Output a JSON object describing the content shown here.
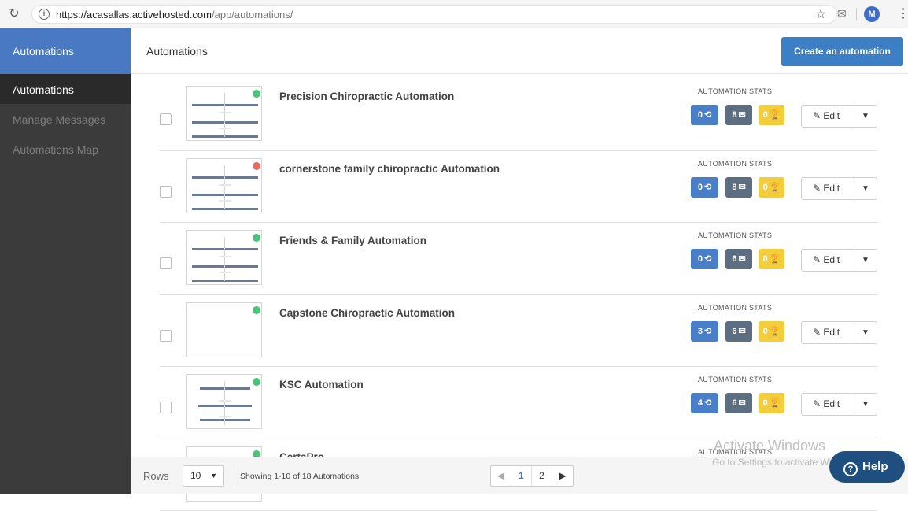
{
  "browser": {
    "url_host": "https://acasallas.activehosted.com",
    "url_path": "/app/automations/",
    "avatar_letter": "M"
  },
  "sidebar": {
    "header": "Automations",
    "items": [
      {
        "label": "Automations",
        "active": true
      },
      {
        "label": "Manage Messages",
        "active": false
      },
      {
        "label": "Automations Map",
        "active": false
      }
    ]
  },
  "header": {
    "title": "Automations",
    "create_label": "Create an automation"
  },
  "stats_label": "AUTOMATION STATS",
  "edit_label": "Edit",
  "automations": [
    {
      "title": "Precision Chiropractic Automation",
      "status": "active",
      "contacts": "0",
      "messages": "8",
      "goals": "0"
    },
    {
      "title": "cornerstone family chiropractic Automation",
      "status": "inactive",
      "contacts": "0",
      "messages": "8",
      "goals": "0"
    },
    {
      "title": "Friends & Family Automation",
      "status": "active",
      "contacts": "0",
      "messages": "6",
      "goals": "0"
    },
    {
      "title": "Capstone Chiropractic Automation",
      "status": "active",
      "contacts": "3",
      "messages": "6",
      "goals": "0"
    },
    {
      "title": "KSC Automation",
      "status": "active",
      "contacts": "4",
      "messages": "6",
      "goals": "0"
    },
    {
      "title": "CertaPro",
      "status": "active",
      "contacts": "",
      "messages": "",
      "goals": ""
    }
  ],
  "colors": {
    "active": "#47c47a",
    "inactive": "#e96a5e"
  },
  "footer": {
    "rows_label": "Rows",
    "rows_value": "10",
    "showing": "Showing 1-10 of 18 Automations",
    "pages": [
      "1",
      "2"
    ],
    "current_page": "1"
  },
  "watermark": {
    "line1": "Activate Windows",
    "line2": "Go to Settings to activate Windows."
  },
  "help_label": "Help"
}
